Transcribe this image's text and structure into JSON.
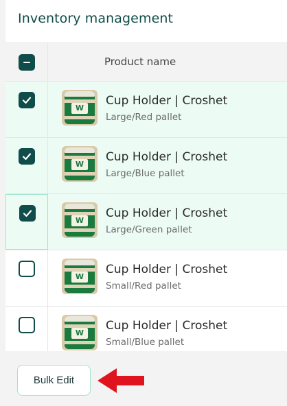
{
  "page": {
    "title": "Inventory management"
  },
  "table": {
    "header": {
      "column_label": "Product name",
      "select_all_state": "indeterminate"
    },
    "rows": [
      {
        "name": "Cup Holder | Croshet",
        "variant": "Large/Red pallet",
        "checked": true,
        "thumb_logo": "W"
      },
      {
        "name": "Cup Holder | Croshet",
        "variant": "Large/Blue pallet",
        "checked": true,
        "thumb_logo": "W"
      },
      {
        "name": "Cup Holder | Croshet",
        "variant": "Large/Green pallet",
        "checked": true,
        "thumb_logo": "W"
      },
      {
        "name": "Cup Holder | Croshet",
        "variant": "Small/Red pallet",
        "checked": false,
        "thumb_logo": "W"
      },
      {
        "name": "Cup Holder | Croshet",
        "variant": "Small/Blue pallet",
        "checked": false,
        "thumb_logo": "W"
      }
    ]
  },
  "actions": {
    "bulk_edit_label": "Bulk Edit"
  },
  "icons": {
    "check": "check-icon",
    "indeterminate": "minus-icon",
    "arrow": "arrow-left-icon"
  },
  "colors": {
    "accent": "#0f4c4a",
    "selected_row": "#ecfbf4",
    "focus_border": "#9fe3d1",
    "arrow": "#e0141e"
  }
}
